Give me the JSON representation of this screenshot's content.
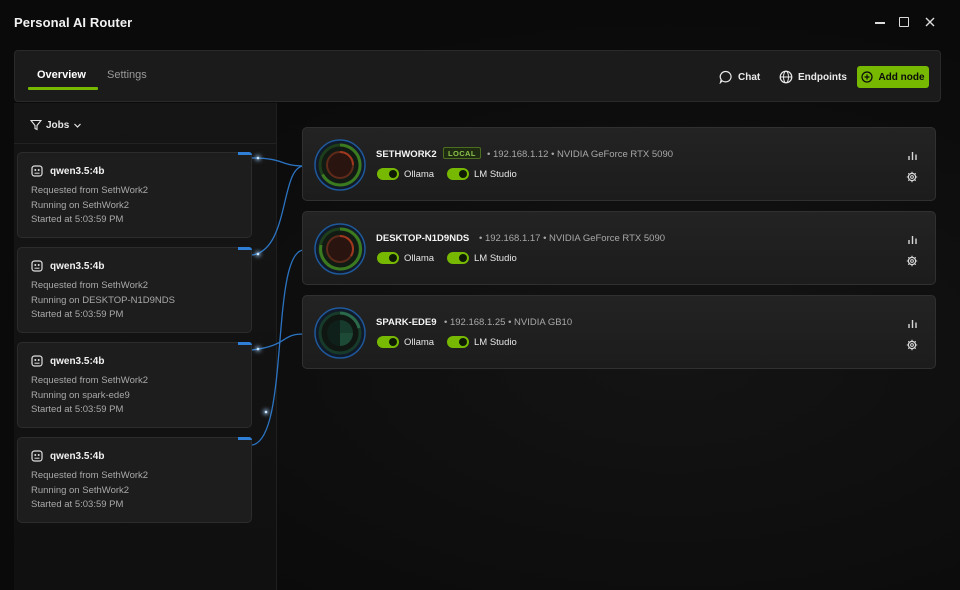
{
  "window": {
    "title": "Personal AI Router"
  },
  "tabs": [
    {
      "label": "Overview",
      "active": true
    },
    {
      "label": "Settings",
      "active": false
    }
  ],
  "toolbar": {
    "chat_label": "Chat",
    "endpoints_label": "Endpoints",
    "add_node_label": "Add node"
  },
  "filter": {
    "label": "Jobs"
  },
  "jobs": [
    {
      "model": "qwen3.5:4b",
      "requested": "Requested from SethWork2",
      "running": "Running on SethWork2",
      "started": "Started at 5:03:59 PM"
    },
    {
      "model": "qwen3.5:4b",
      "requested": "Requested from SethWork2",
      "running": "Running on DESKTOP-N1D9NDS",
      "started": "Started at 5:03:59 PM"
    },
    {
      "model": "qwen3.5:4b",
      "requested": "Requested from SethWork2",
      "running": "Running on spark-ede9",
      "started": "Started at 5:03:59 PM"
    },
    {
      "model": "qwen3.5:4b",
      "requested": "Requested from SethWork2",
      "running": "Running on SethWork2",
      "started": "Started at 5:03:59 PM"
    }
  ],
  "nodes": [
    {
      "name": "SETHWORK2",
      "badge": "LOCAL",
      "meta": "• 192.168.1.12  • NVIDIA GeForce RTX 5090",
      "services": [
        "Ollama",
        "LM Studio"
      ]
    },
    {
      "name": "DESKTOP-N1D9NDS",
      "badge": "",
      "meta": "• 192.168.1.17  • NVIDIA GeForce RTX 5090",
      "services": [
        "Ollama",
        "LM Studio"
      ]
    },
    {
      "name": "SPARK-EDE9",
      "badge": "",
      "meta": "• 192.168.1.25  • NVIDIA GB10",
      "services": [
        "Ollama",
        "LM Studio"
      ]
    }
  ],
  "colors": {
    "accent": "#76b900",
    "link": "#2f7fd6",
    "background": "#0c0c0c"
  }
}
